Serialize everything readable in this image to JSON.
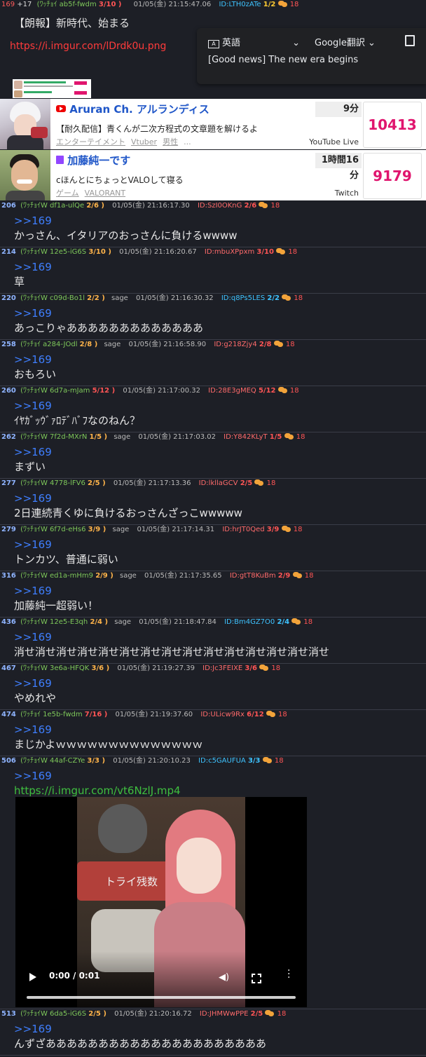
{
  "op": {
    "num": "169",
    "plus": "+17",
    "name": "(ﾜｯﾁｮｲ ab5f-fwdm",
    "count": "3/10 )",
    "date": "01/05(金) 21:15:47.06",
    "id": "ID:LTH0zATe",
    "id_count": "1/2",
    "replies": "18",
    "title": "【朗報】新時代、始まる",
    "link": "https://i.imgur.com/lDrdk0u.png"
  },
  "translate_popup": {
    "lang": "英語",
    "service": "Google翻訳",
    "text": "[Good news] The new era begins"
  },
  "cards": [
    {
      "icon": "youtube-icon",
      "title": "Aruran Ch. アルランディス",
      "time": "9分",
      "desc": "【耐久配信】青くんが二次方程式の文章題を解けるよ",
      "tags": [
        "エンターテイメント",
        "Vtuber",
        "男性",
        "..."
      ],
      "source": "YouTube Live",
      "viewers": "10413"
    },
    {
      "icon": "twitch-icon",
      "title": "加藤純一です",
      "time": "1時間16分",
      "desc": "cほんとにちょっとVALOして寝る",
      "tags": [
        "ゲーム",
        "VALORANT"
      ],
      "source": "Twitch",
      "viewers": "9179"
    }
  ],
  "posts": [
    {
      "num": "206",
      "name": "(ﾜｯﾁｮｲW df1a-ulQe",
      "count": "2/6 )",
      "sage": "",
      "date": "01/05(金) 21:16:17.30",
      "id": "ID:SzI0OKnG",
      "id_count": "2/6",
      "replies": "18",
      "anchor": ">>169",
      "text": "かっさん、イタリアのおっさんに負けるwwww"
    },
    {
      "num": "214",
      "name": "(ﾜｯﾁｮｲW 12e5-iG6S",
      "count": "3/10 )",
      "sage": "",
      "date": "01/05(金) 21:16:20.67",
      "id": "ID:mbuXPpxm",
      "id_count": "3/10",
      "replies": "18",
      "anchor": ">>169",
      "text": "草"
    },
    {
      "num": "220",
      "name": "(ﾜｯﾁｮｲW c09d-Bo1l",
      "count": "2/2 )",
      "sage": "sage",
      "date": "01/05(金) 21:16:30.32",
      "id": "ID:q8Ps5LES",
      "id_count": "2/2",
      "replies": "18",
      "anchor": ">>169",
      "text": "あっこりゃあああああああああああああ"
    },
    {
      "num": "258",
      "name": "(ﾜｯﾁｮｲ a284-JOdl",
      "count": "2/8 )",
      "sage": "sage",
      "date": "01/05(金) 21:16:58.90",
      "id": "ID:g218Zjy4",
      "id_count": "2/8",
      "replies": "18",
      "anchor": ">>169",
      "text": "おもろい"
    },
    {
      "num": "260",
      "name": "(ﾜｯﾁｮｲW 6d7a-mJam",
      "count": "5/12 )",
      "sage": "",
      "date": "01/05(金) 21:17:00.32",
      "id": "ID:28E3gMEQ",
      "id_count": "5/12",
      "replies": "18",
      "anchor": ">>169",
      "text": "ｲﾔｶﾞｯｳﾞｧﾛﾃﾞﾊﾞﾌなのねん？"
    },
    {
      "num": "262",
      "name": "(ﾜｯﾁｮｲW 7f2d-MXrN",
      "count": "1/5 )",
      "sage": "sage",
      "date": "01/05(金) 21:17:03.02",
      "id": "ID:Y842KLyT",
      "id_count": "1/5",
      "replies": "18",
      "anchor": ">>169",
      "text": "まずい"
    },
    {
      "num": "277",
      "name": "(ﾜｯﾁｮｲW 4778-lFV6",
      "count": "2/5 )",
      "sage": "",
      "date": "01/05(金) 21:17:13.36",
      "id": "ID:lkllaGCV",
      "id_count": "2/5",
      "replies": "18",
      "anchor": ">>169",
      "text": "2日連続青くゆに負けるおっさんざっこwwwww"
    },
    {
      "num": "279",
      "name": "(ﾜｯﾁｮｲW 6f7d-eHs6",
      "count": "3/9 )",
      "sage": "sage",
      "date": "01/05(金) 21:17:14.31",
      "id": "ID:hrJT0Qed",
      "id_count": "3/9",
      "replies": "18",
      "anchor": ">>169",
      "text": "トンカツ、普通に弱い"
    },
    {
      "num": "316",
      "name": "(ﾜｯﾁｮｲW ed1a-mHm9",
      "count": "2/9 )",
      "sage": "sage",
      "date": "01/05(金) 21:17:35.65",
      "id": "ID:gtT8KuBm",
      "id_count": "2/9",
      "replies": "18",
      "anchor": ">>169",
      "text": "加藤純一超弱い！"
    },
    {
      "num": "436",
      "name": "(ﾜｯﾁｮｲW 12e5-E3qh",
      "count": "2/4 )",
      "sage": "sage",
      "date": "01/05(金) 21:18:47.84",
      "id": "ID:Bm4GZ7O0",
      "id_count": "2/4",
      "replies": "18",
      "anchor": ">>169",
      "text": "消せ消せ消せ消せ消せ消せ消せ消せ消せ消せ消せ消せ消せ消せ消せ"
    },
    {
      "num": "467",
      "name": "(ﾜｯﾁｮｲW 3e6a-HFQK",
      "count": "3/6 )",
      "sage": "",
      "date": "01/05(金) 21:19:27.39",
      "id": "ID:Jc3FEIXE",
      "id_count": "3/6",
      "replies": "18",
      "anchor": ">>169",
      "text": "やめれや"
    },
    {
      "num": "474",
      "name": "(ﾜｯﾁｮｲ 1e5b-fwdm",
      "count": "7/16 )",
      "sage": "",
      "date": "01/05(金) 21:19:37.60",
      "id": "ID:ULicw9Rx",
      "id_count": "6/12",
      "replies": "18",
      "anchor": ">>169",
      "text": "まじかよｗｗｗｗｗｗｗｗｗｗｗｗｗｗ"
    },
    {
      "num": "506",
      "name": "(ﾜｯﾁｮｲW 44af-CZYe",
      "count": "3/3 )",
      "sage": "",
      "date": "01/05(金) 21:20:10.23",
      "id": "ID:c5GAUFUA",
      "id_count": "3/3",
      "replies": "18",
      "anchor": ">>169",
      "text": "",
      "link": "https://i.imgur.com/vt6NzlJ.mp4"
    },
    {
      "num": "513",
      "name": "(ﾜｯﾁｮｲW 6da5-iG6S",
      "count": "2/5 )",
      "sage": "",
      "date": "01/05(金) 21:20:16.72",
      "id": "ID:JHMWwPPE",
      "id_count": "2/5",
      "replies": "18",
      "anchor": ">>169",
      "text": "んずざあああああああああああああああああああああ"
    }
  ],
  "video": {
    "sign_text": "トライ残数",
    "time": "0:00 / 0:01"
  }
}
